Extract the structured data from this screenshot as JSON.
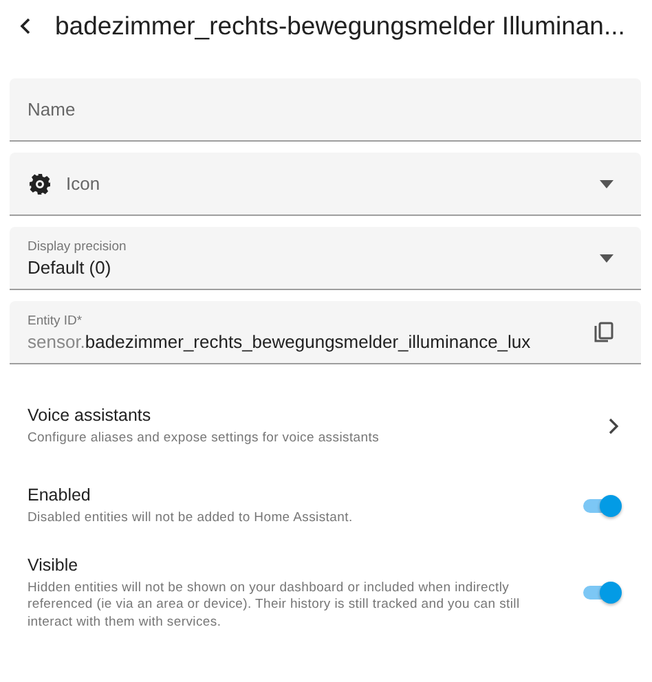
{
  "header": {
    "title": "badezimmer_rechts-bewegungsmelder Illuminan..."
  },
  "fields": [
    {
      "kind": "text",
      "placeholder": "Name"
    },
    {
      "kind": "icon-select",
      "placeholder": "Icon"
    },
    {
      "kind": "select",
      "label": "Display precision",
      "value": "Default (0)"
    },
    {
      "kind": "entity",
      "label": "Entity ID*",
      "prefix": "sensor.",
      "value": "badezimmer_rechts_bewegungsmelder_illuminance_lux"
    }
  ],
  "settings": [
    {
      "kind": "link",
      "title": "Voice assistants",
      "description": "Configure aliases and expose settings for voice assistants"
    },
    {
      "kind": "toggle",
      "title": "Enabled",
      "description": "Disabled entities will not be added to Home Assistant.",
      "on": true
    },
    {
      "kind": "toggle",
      "title": "Visible",
      "description": "Hidden entities will not be shown on your dashboard or included when indirectly referenced (ie via an area or device). Their history is still tracked and you can still interact with them with services.",
      "on": true
    }
  ]
}
